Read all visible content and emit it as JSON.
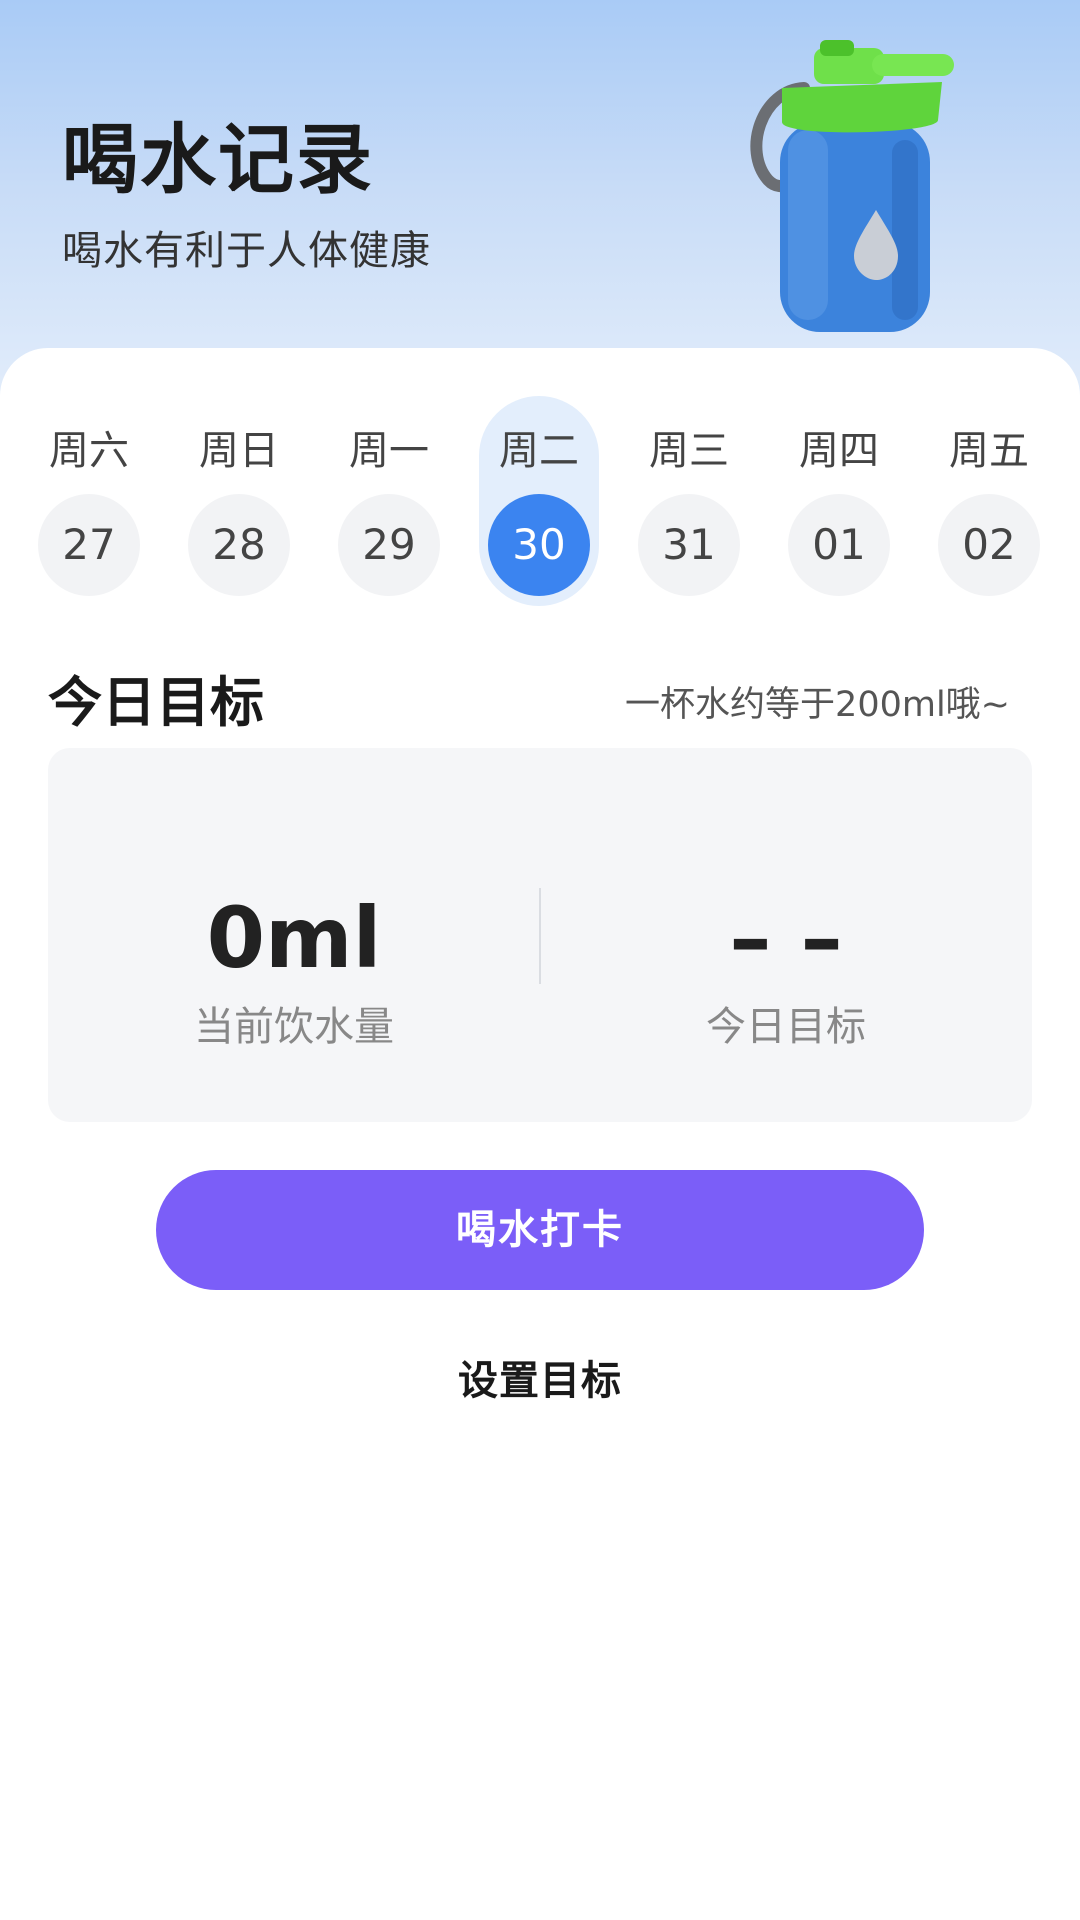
{
  "header": {
    "title": "喝水记录",
    "subtitle": "喝水有利于人体健康",
    "illustration": "water-bottle-icon"
  },
  "week": {
    "days": [
      {
        "label": "周六",
        "date": "27",
        "selected": false
      },
      {
        "label": "周日",
        "date": "28",
        "selected": false
      },
      {
        "label": "周一",
        "date": "29",
        "selected": false
      },
      {
        "label": "周二",
        "date": "30",
        "selected": true
      },
      {
        "label": "周三",
        "date": "31",
        "selected": false
      },
      {
        "label": "周四",
        "date": "01",
        "selected": false
      },
      {
        "label": "周五",
        "date": "02",
        "selected": false
      }
    ]
  },
  "goal": {
    "title": "今日目标",
    "hint": "一杯水约等于200ml哦~",
    "current_value": "0ml",
    "current_label": "当前饮水量",
    "target_value": "– –",
    "target_label": "今日目标"
  },
  "actions": {
    "checkin_label": "喝水打卡",
    "set_goal_label": "设置目标"
  },
  "colors": {
    "accent_blue": "#3b84f0",
    "button_purple": "#7b5ef8",
    "selected_pill": "#e3eefc",
    "hero_top": "#a9cbf6"
  }
}
